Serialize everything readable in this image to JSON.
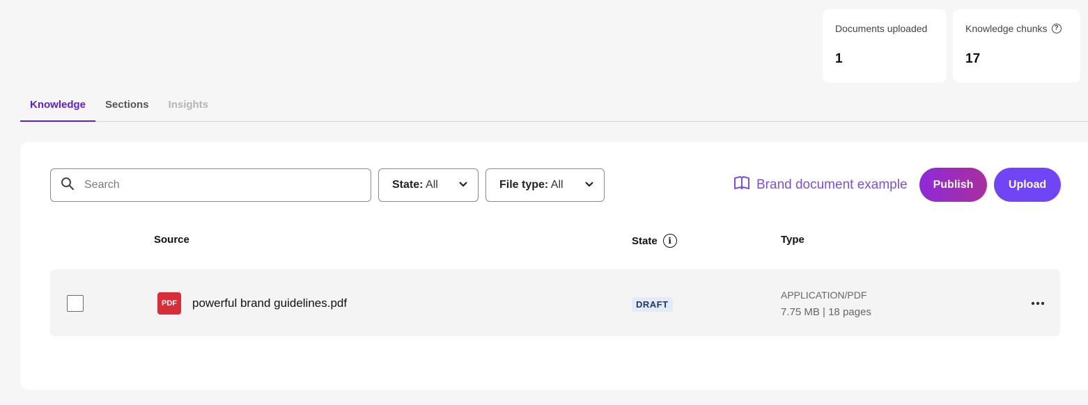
{
  "stats": {
    "documents_uploaded": {
      "label": "Documents uploaded",
      "value": "1"
    },
    "knowledge_chunks": {
      "label": "Knowledge chunks",
      "value": "17"
    }
  },
  "tabs": [
    {
      "label": "Knowledge",
      "state": "active"
    },
    {
      "label": "Sections",
      "state": "normal"
    },
    {
      "label": "Insights",
      "state": "disabled"
    }
  ],
  "toolbar": {
    "search_placeholder": "Search",
    "state_filter": {
      "key": "State:",
      "value": "All"
    },
    "filetype_filter": {
      "key": "File type:",
      "value": "All"
    },
    "example_link": "Brand document example",
    "publish_label": "Publish",
    "upload_label": "Upload"
  },
  "table": {
    "columns": {
      "source": "Source",
      "state": "State",
      "type": "Type"
    },
    "rows": [
      {
        "icon_text": "PDF",
        "filename": "powerful brand guidelines.pdf",
        "state": "DRAFT",
        "type": "APPLICATION/PDF",
        "meta": "7.75 MB | 18 pages"
      }
    ]
  },
  "colors": {
    "accent": "#5b21d6",
    "link": "#7c4dea",
    "upload": "#7045f5",
    "pdf": "#d92d3a",
    "draft_badge_bg": "#e4ebf8"
  }
}
